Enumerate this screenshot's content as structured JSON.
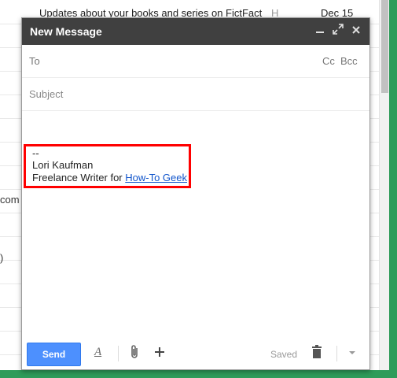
{
  "background": {
    "top_email_subject": "Updates about your books and series on FictFact",
    "top_email_sender": "H",
    "top_email_date": "Dec 15",
    "left_fragment_1": "com",
    "left_fragment_2": ")"
  },
  "compose": {
    "title": "New Message",
    "minimize_icon": "minimize-icon",
    "expand_icon": "expand-icon",
    "close_icon": "close-icon",
    "to_label": "To",
    "cc_label": "Cc",
    "bcc_label": "Bcc",
    "subject_placeholder": "Subject",
    "signature": {
      "dashes": "--",
      "name": "Lori Kaufman",
      "role_prefix": "Freelance Writer for ",
      "link_text": "How-To Geek"
    },
    "footer": {
      "send_label": "Send",
      "format_icon": "A",
      "saved_label": "Saved"
    }
  },
  "colors": {
    "header_bg": "#404040",
    "send_button": "#4d90fe",
    "highlight_border": "#ff0000",
    "link": "#1155cc",
    "window_edge": "#2e9c5a"
  }
}
